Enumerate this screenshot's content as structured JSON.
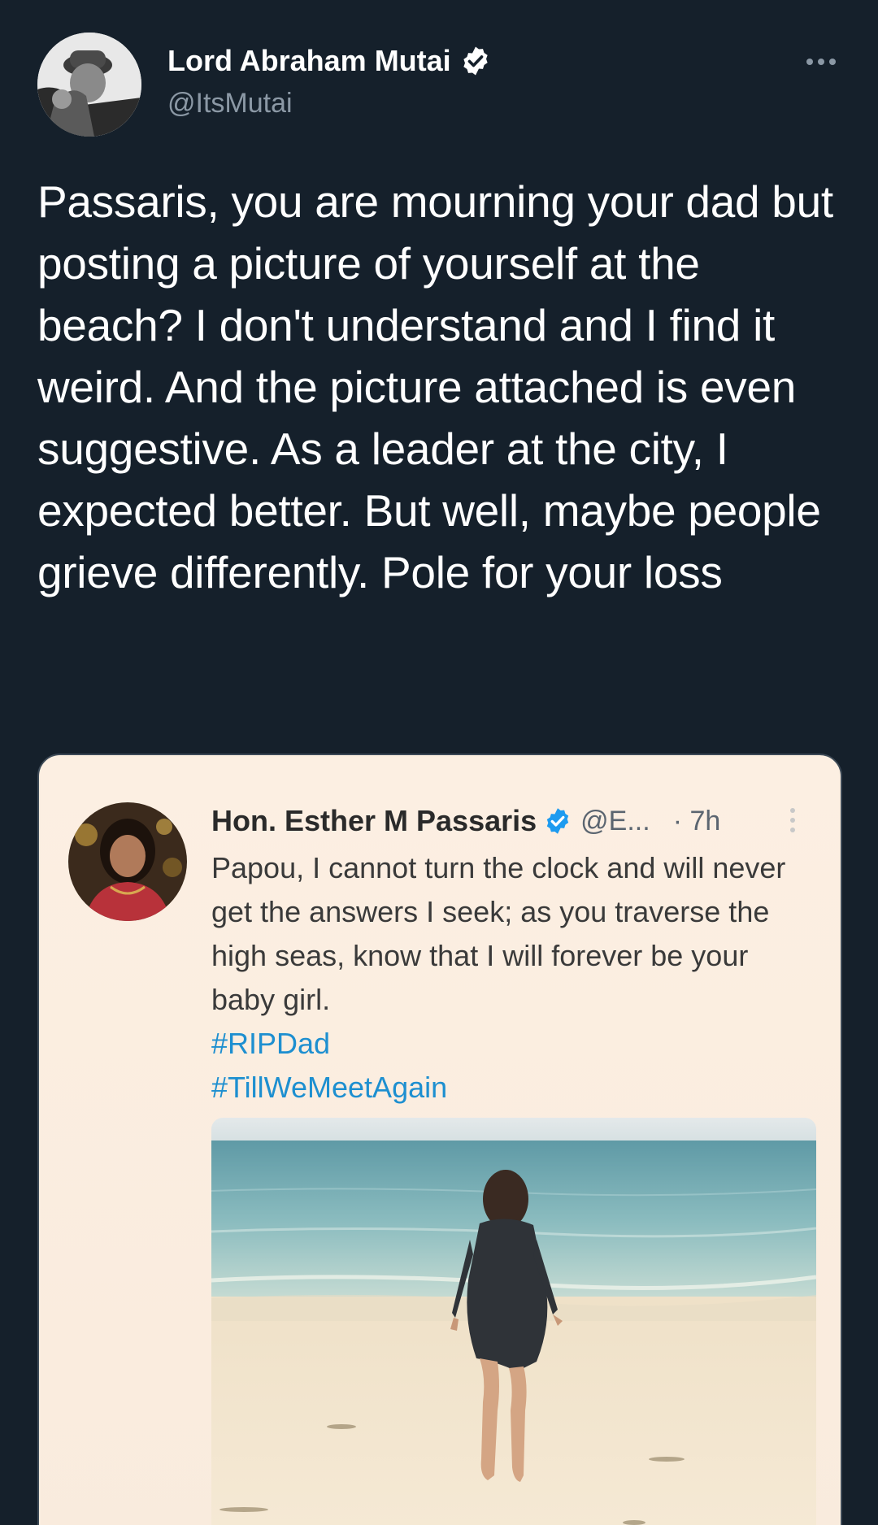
{
  "tweet": {
    "author_name": "Lord Abraham Mutai",
    "author_handle": "@ItsMutai",
    "text": "Passaris, you are mourning your dad but posting a picture of yourself at the beach? I don't understand and I find it weird. And the picture attached is even suggestive. As a leader at the city, I expected better. But well, maybe people grieve differently. Pole for your loss"
  },
  "quoted": {
    "author_name": "Hon. Esther M Passaris",
    "author_handle": "@E...",
    "time": "· 7h",
    "text": "Papou, I cannot turn the clock and will never get the answers I seek; as you traverse the high seas, know that I will forever be your baby girl.",
    "hashtags": [
      "#RIPDad",
      "#TillWeMeetAgain"
    ]
  },
  "colors": {
    "background": "#15202b",
    "verified": "#1d9bf0",
    "hashtag": "#1d8fd0",
    "quote_card_bg": "#fbeee0"
  },
  "icons": {
    "verified": "verified-icon",
    "more": "more-horizontal-icon",
    "quoted_more": "more-vertical-icon"
  }
}
